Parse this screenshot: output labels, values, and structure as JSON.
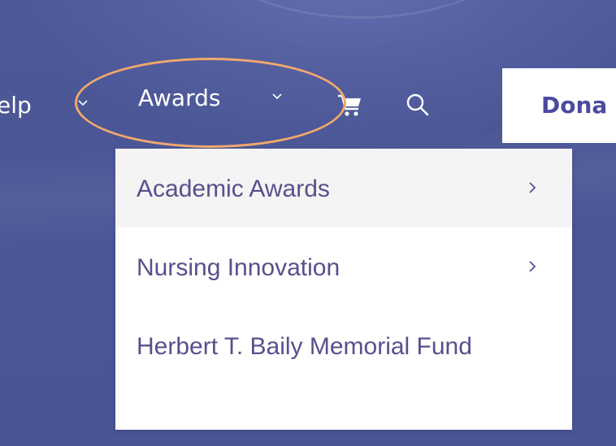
{
  "nav": {
    "help_label": "elp",
    "awards_label": "Awards",
    "donate_label": "Dona",
    "icons": {
      "help_chevron": "chevron-down-icon",
      "awards_chevron": "chevron-down-icon",
      "cart": "cart-icon",
      "search": "search-icon"
    }
  },
  "dropdown": {
    "items": [
      {
        "label": "Academic Awards",
        "has_submenu": true,
        "highlighted": true
      },
      {
        "label": "Nursing Innovation",
        "has_submenu": true,
        "highlighted": false
      },
      {
        "label": "Herbert T. Baily Memorial Fund",
        "has_submenu": false,
        "highlighted": false
      }
    ]
  },
  "colors": {
    "background": "#4f5a9b",
    "nav_text": "#ffffff",
    "menu_text": "#5a4f8c",
    "donate_text": "#4c4a9f",
    "highlight_annotation": "#f1a86c",
    "menu_hover": "#f4f4f5"
  }
}
